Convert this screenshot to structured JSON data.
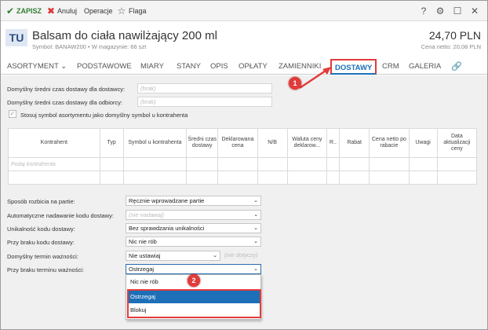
{
  "toolbar": {
    "save": "ZAPISZ",
    "cancel": "Anuluj",
    "operations": "Operacje",
    "flag": "Flaga"
  },
  "header": {
    "avatar": "TU",
    "title": "Balsam do ciała nawilżający 200 ml",
    "subtitle": "Symbol: BANAW200  •  W magazynie: 66 szt",
    "price": "24,70 PLN",
    "netto": "Cena netto: 20,08 PLN"
  },
  "tabs": [
    "ASORTYMENT",
    "PODSTAWOWE",
    "MIARY",
    "STANY",
    "OPIS",
    "OPŁATY",
    "ZAMIENNIKI",
    "DOSTAWY",
    "CRM",
    "GALERIA"
  ],
  "form": {
    "avg_supplier_label": "Domyślny średni czas dostawy dla dostawcy:",
    "avg_supplier_value": "(brak)",
    "avg_recipient_label": "Domyślny średni czas dostawy dla odbiorcy:",
    "avg_recipient_value": "(brak)",
    "symbol_checkbox_label": "Stosuj symbol asortymentu jako domyślny symbol u kontrahenta"
  },
  "table": {
    "headers": [
      "Kontrahent",
      "Typ",
      "Symbol u kontrahenta",
      "Średni czas dostawy",
      "Deklarowana cena",
      "N/B",
      "Waluta ceny deklarow...",
      "R..",
      "Rabat",
      "Cena netto po rabacie",
      "Uwagi",
      "Data aktualizacji ceny"
    ],
    "filter_placeholder": "Podaj kontrahenta"
  },
  "settings": {
    "split_label": "Sposób rozbicia na partie:",
    "split_value": "Ręcznie wprowadzane partie",
    "auto_code_label": "Automatyczne nadawanie kodu dostawy:",
    "auto_code_value": "(nie nadawaj)",
    "unique_label": "Unikalność kodu dostawy:",
    "unique_value": "Bez sprawdzania unikalności",
    "no_code_label": "Przy braku kodu dostawy:",
    "no_code_value": "Nic nie rób",
    "expiry_label": "Domyślny termin ważności:",
    "expiry_value": "Nie ustawiaj",
    "expiry_hint": "(nie dotyczy)",
    "no_expiry_label": "Przy braku terminu ważności:",
    "no_expiry_value": "Ostrzegaj"
  },
  "dropdown": {
    "options": [
      "Nic nie rób",
      "Ostrzegaj",
      "Blokuj"
    ]
  },
  "annotations": {
    "badge1": "1",
    "badge2": "2"
  },
  "colors": {
    "accent": "#1d6fb8",
    "highlight": "#e23b3b",
    "save": "#2f7d32"
  }
}
